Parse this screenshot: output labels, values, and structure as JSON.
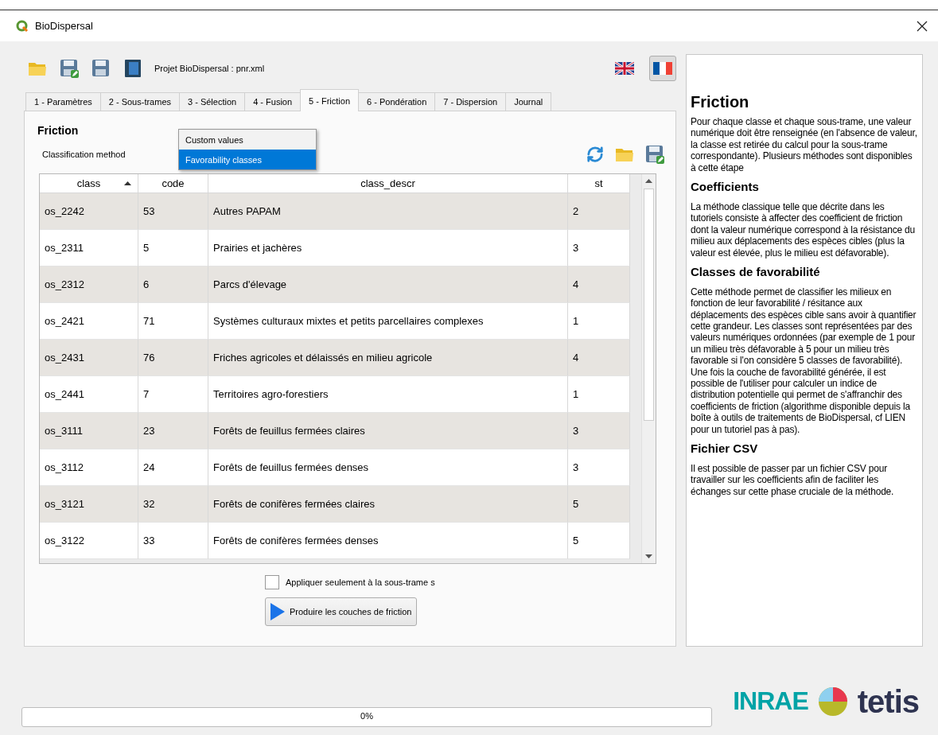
{
  "window": {
    "title": "BioDispersal"
  },
  "toolbar": {
    "project_label": "Projet BioDispersal : pnr.xml",
    "languages": [
      {
        "kind": "uk",
        "selected": false
      },
      {
        "kind": "fr",
        "selected": true
      }
    ]
  },
  "tabs": [
    {
      "label": "1 - Paramètres",
      "selected": false
    },
    {
      "label": "2 - Sous-trames",
      "selected": false
    },
    {
      "label": "3 - Sélection",
      "selected": false
    },
    {
      "label": "4 - Fusion",
      "selected": false
    },
    {
      "label": "5 - Friction",
      "selected": true
    },
    {
      "label": "6 - Pondération",
      "selected": false
    },
    {
      "label": "7 - Dispersion",
      "selected": false
    },
    {
      "label": "Journal",
      "selected": false
    }
  ],
  "friction": {
    "title": "Friction",
    "method_label": "Classification method",
    "method_options": [
      {
        "label": "Custom values",
        "selected": false
      },
      {
        "label": "Favorability classes",
        "selected": true
      }
    ],
    "table": {
      "columns": [
        "class",
        "code",
        "class_descr",
        "st"
      ],
      "rows": [
        [
          "os_2242",
          "53",
          "Autres PAPAM",
          "2"
        ],
        [
          "os_2311",
          "5",
          "Prairies et jachères",
          "3"
        ],
        [
          "os_2312",
          "6",
          "Parcs d'élevage",
          "4"
        ],
        [
          "os_2421",
          "71",
          "Systèmes culturaux mixtes et petits parcellaires complexes",
          "1"
        ],
        [
          "os_2431",
          "76",
          "Friches agricoles et délaissés en milieu agricole",
          "4"
        ],
        [
          "os_2441",
          "7",
          "Territoires agro-forestiers",
          "1"
        ],
        [
          "os_3111",
          "23",
          "Forêts de feuillus fermées claires",
          "3"
        ],
        [
          "os_3112",
          "24",
          "Forêts de feuillus fermées denses",
          "3"
        ],
        [
          "os_3121",
          "32",
          "Forêts de conifères fermées claires",
          "5"
        ],
        [
          "os_3122",
          "33",
          "Forêts de conifères fermées denses",
          "5"
        ]
      ]
    },
    "apply_checkbox": {
      "label": "Appliquer seulement à la sous-trame s",
      "checked": false
    },
    "run_button": "Produire les couches de friction"
  },
  "help": [
    {
      "kind": "title",
      "text": "Friction"
    },
    {
      "kind": "para",
      "text": "Pour chaque classe et chaque sous-trame, une valeur numérique doit être renseignée (en l'absence de valeur, la classe est retirée du calcul pour la sous-trame correspondante). Plusieurs méthodes sont disponibles à cette étape"
    },
    {
      "kind": "heading",
      "text": "Coefficients"
    },
    {
      "kind": "para",
      "text": "La méthode classique telle que décrite dans les tutoriels consiste à affecter des coefficient de friction dont la valeur numérique correspond à la résistance du milieu aux déplacements des espèces cibles (plus la valeur est élevée, plus le milieu est défavorable)."
    },
    {
      "kind": "heading",
      "text": "Classes de favorabilité"
    },
    {
      "kind": "para",
      "text": "Cette méthode permet de classifier les milieux en fonction de leur favorabilité / résitance aux déplacements des espèces cible sans avoir à quantifier cette grandeur. Les classes sont représentées par des valeurs numériques ordonnées (par exemple de 1 pour un milieu très défavorable à 5 pour un milieu très favorable si l'on considère 5 classes de favorabilité)."
    },
    {
      "kind": "para",
      "text": "Une fois la couche de favorabilité générée, il est possible de l'utiliser pour calculer un indice de distribution potentielle qui permet de s'affranchir des coefficients de friction (algorithme disponible depuis la boîte à outils de traitements de BioDispersal, cf LIEN pour un tutoriel pas à pas)."
    },
    {
      "kind": "heading",
      "text": "Fichier CSV"
    },
    {
      "kind": "para",
      "text": "Il est possible de passer par un fichier CSV pour travailler sur les coefficients afin de faciliter les échanges sur cette phase cruciale de la méthode."
    }
  ],
  "logos": {
    "inrae": "INRAE",
    "tetis": "tetis"
  },
  "progress": {
    "level": 0,
    "text": "0%"
  }
}
